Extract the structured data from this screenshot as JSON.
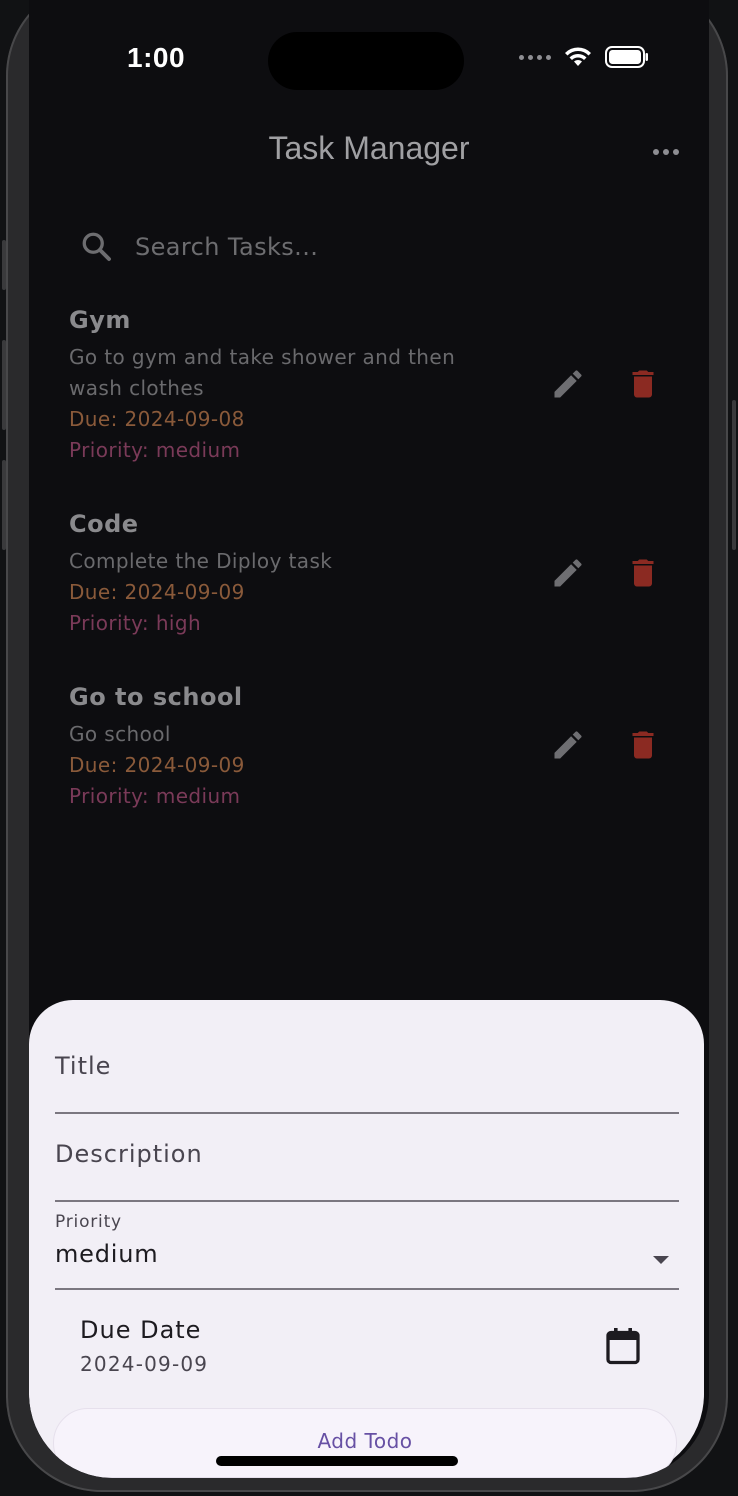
{
  "status_bar": {
    "time": "1:00"
  },
  "app": {
    "title": "Task Manager",
    "more_icon": "more-horizontal-icon"
  },
  "search": {
    "placeholder": "Search Tasks...",
    "icon": "search-icon"
  },
  "tasks": [
    {
      "title": "Gym",
      "description": "Go to gym and take shower and then wash clothes",
      "due": "Due: 2024-09-08",
      "priority": "Priority: medium"
    },
    {
      "title": "Code",
      "description": "Complete the Diploy task",
      "due": "Due: 2024-09-09",
      "priority": "Priority: high"
    },
    {
      "title": "Go to school",
      "description": "Go school",
      "due": "Due: 2024-09-09",
      "priority": "Priority: medium"
    }
  ],
  "form": {
    "title_label": "Title",
    "description_label": "Description",
    "priority_label": "Priority",
    "priority_value": "medium",
    "due_date_label": "Due Date",
    "due_date_value": "2024-09-09",
    "submit_label": "Add Todo"
  },
  "colors": {
    "accent": "#6750a4",
    "delete": "#8b2a22",
    "due": "#8a5a3a",
    "priority": "#7a3a58",
    "sheet_bg": "#f2eff6"
  }
}
